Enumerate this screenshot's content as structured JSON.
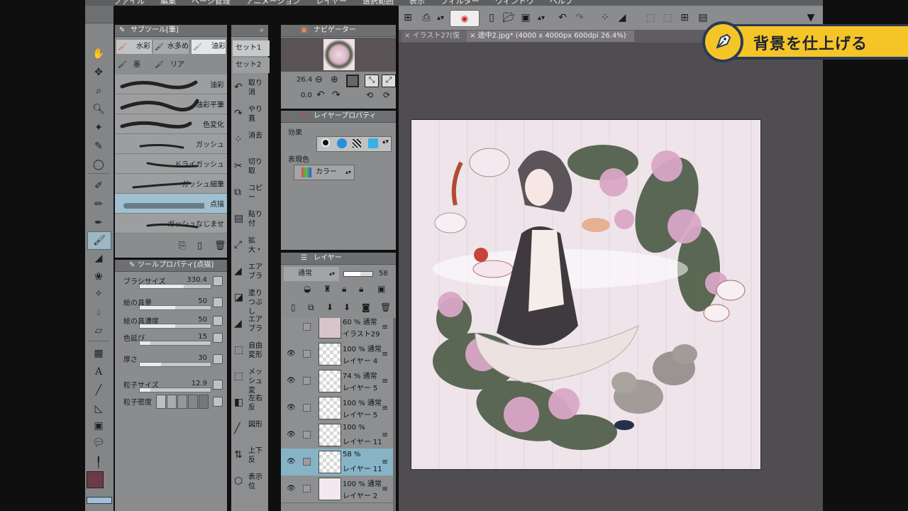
{
  "menubar": [
    "ファイル",
    "編集",
    "ページ管理",
    "アニメーション",
    "レイヤー",
    "選択範囲",
    "表示",
    "フィルター",
    "ウィンドウ",
    "ヘルプ"
  ],
  "subtool": {
    "header": "サブツール[筆]",
    "tabs": [
      "水彩",
      "水多め",
      "油彩",
      "墨",
      "リアル"
    ],
    "brushes": [
      "油彩",
      "油彩平筆",
      "色変化",
      "ガッシュ",
      "ドライガッシュ",
      "ガッシュ細筆",
      "点描",
      "ガッシュなじませ"
    ]
  },
  "toolprop": {
    "header": "ツールプロパティ[点描]",
    "rows": [
      {
        "name": "ブラシサイズ",
        "value": "330.4",
        "fill": 0.62
      },
      {
        "name": "絵の具量",
        "value": "50",
        "fill": 0.5
      },
      {
        "name": "絵の具濃度",
        "value": "50",
        "fill": 0.5
      },
      {
        "name": "色延び",
        "value": "15",
        "fill": 0.15
      },
      {
        "name": "厚さ",
        "value": "30",
        "fill": 0.3
      },
      {
        "name": "粒子サイズ",
        "value": "12.9",
        "fill": 0.15
      },
      {
        "name": "粒子密度",
        "value": "",
        "fill": 0
      }
    ]
  },
  "set": {
    "items": [
      "セット1",
      "セット2"
    ]
  },
  "commands": [
    {
      "icon": "↶",
      "label": "取り消"
    },
    {
      "icon": "↷",
      "label": "やり直"
    },
    {
      "icon": "⁘",
      "label": "消去"
    },
    {
      "icon": "✂",
      "label": "切り取"
    },
    {
      "icon": "⧉",
      "label": "コピー"
    },
    {
      "icon": "▤",
      "label": "貼り付"
    },
    {
      "icon": "⤢",
      "label": "拡大・"
    },
    {
      "icon": "◢",
      "label": "エアブラ"
    },
    {
      "icon": "◪",
      "label": "塗りつぶし"
    },
    {
      "icon": "◢",
      "label": "エアブラ"
    },
    {
      "icon": "⬚",
      "label": "自由変形"
    },
    {
      "icon": "⬚",
      "label": "メッシュ変"
    },
    {
      "icon": "◧",
      "label": "左右反"
    },
    {
      "icon": "╱",
      "label": "図形"
    },
    {
      "icon": "⇅",
      "label": "上下反"
    },
    {
      "icon": "⬡",
      "label": "表示位"
    }
  ],
  "navigator": {
    "header": "ナビゲーター",
    "zoom": "26.4",
    "rotation": "0.0"
  },
  "layerprop": {
    "header": "レイヤープロパティ",
    "effect_label": "効果",
    "express_label": "表現色",
    "color_mode": "カラー"
  },
  "layers": {
    "header": "レイヤー",
    "blend": "通常",
    "opacity": "58",
    "items": [
      {
        "l1": "60 % 通常",
        "l2": "イラスト29"
      },
      {
        "l1": "100 % 通常",
        "l2": "レイヤー 4"
      },
      {
        "l1": "74 % 通常",
        "l2": "レイヤー 5"
      },
      {
        "l1": "100 % 通常",
        "l2": "レイヤー 5"
      },
      {
        "l1": "100 %",
        "l2": "レイヤー 11"
      },
      {
        "l1": "58 %",
        "l2": "レイヤー 11"
      },
      {
        "l1": "100 % 通常",
        "l2": "レイヤー 2"
      }
    ]
  },
  "tabs": {
    "tab1": "イラスト27(復",
    "tab2": "途中2.jpg* (4000 x 4000px 600dpi 26.4%)"
  },
  "banner": {
    "text": "背景を仕上げる"
  },
  "colors": {
    "accent": "#f5c528",
    "banner_border": "#2b3b55",
    "main_color": "#6e3a45"
  }
}
